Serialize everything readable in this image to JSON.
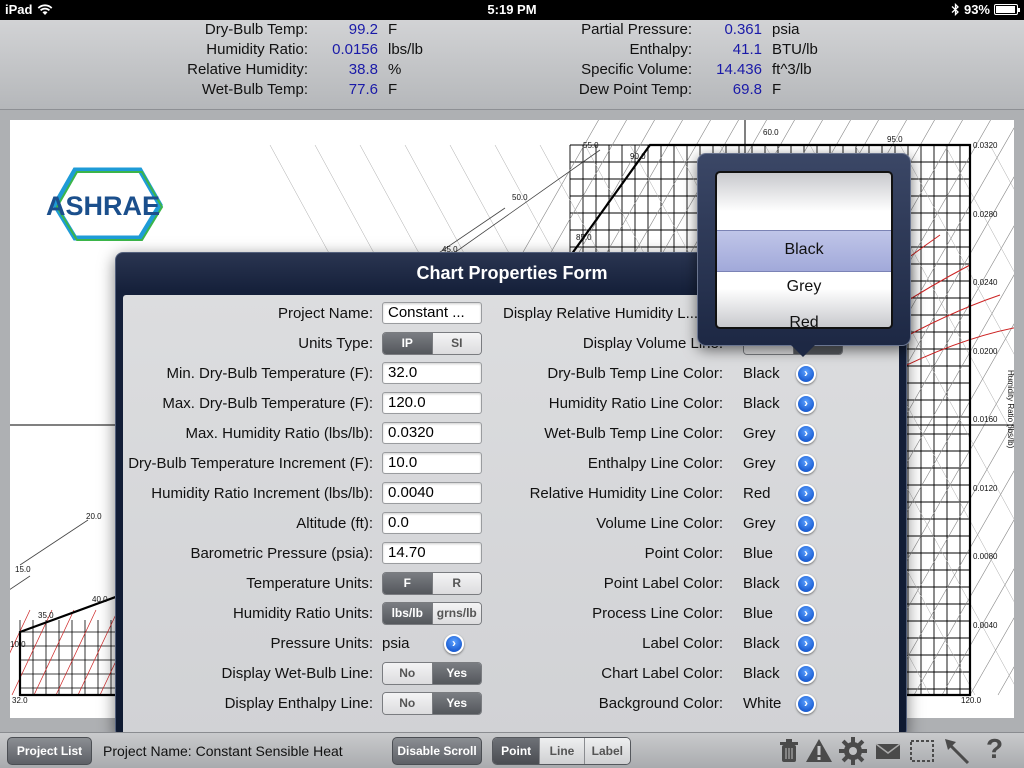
{
  "status_bar": {
    "device": "iPad",
    "time": "5:19 PM",
    "battery_pct": "93%",
    "battery_level": 0.93
  },
  "readouts": {
    "left": [
      {
        "label": "Dry-Bulb Temp:",
        "value": "99.2",
        "unit": "F"
      },
      {
        "label": "Humidity Ratio:",
        "value": "0.0156",
        "unit": "lbs/lb"
      },
      {
        "label": "Relative Humidity:",
        "value": "38.8",
        "unit": "%"
      },
      {
        "label": "Wet-Bulb Temp:",
        "value": "77.6",
        "unit": "F"
      }
    ],
    "right": [
      {
        "label": "Partial Pressure:",
        "value": "0.361",
        "unit": "psia"
      },
      {
        "label": "Enthalpy:",
        "value": "41.1",
        "unit": "BTU/lb"
      },
      {
        "label": "Specific Volume:",
        "value": "14.436",
        "unit": "ft^3/lb"
      },
      {
        "label": "Dew Point Temp:",
        "value": "69.8",
        "unit": "F"
      }
    ]
  },
  "chart": {
    "logo_text": "ASHRAE",
    "top_labels": [
      "55.0",
      "60.0",
      "95.0",
      "90.0",
      "50.0",
      "85.0",
      "45.0"
    ],
    "left_labels": [
      "20.0",
      "15.0",
      "10.0",
      "35.0",
      "40.0"
    ],
    "bottom_labels": [
      "32.0",
      "120.0"
    ],
    "right_axis_ticks": [
      "0.0320",
      "0.0280",
      "0.0240",
      "0.0200",
      "0.0160",
      "0.0120",
      "0.0080",
      "0.0040"
    ],
    "right_axis_title": "Humidity Ratio (lbs/lb)"
  },
  "form": {
    "title": "Chart Properties Form",
    "left_fields": [
      {
        "label": "Project Name:",
        "type": "text",
        "value": "Constant ..."
      },
      {
        "label": "Units Type:",
        "type": "segment",
        "options": [
          "IP",
          "SI"
        ],
        "selected": 0
      },
      {
        "label": "Min. Dry-Bulb Temperature (F):",
        "type": "text",
        "value": "32.0"
      },
      {
        "label": "Max. Dry-Bulb Temperature (F):",
        "type": "text",
        "value": "120.0"
      },
      {
        "label": "Max. Humidity Ratio (lbs/lb):",
        "type": "text",
        "value": "0.0320"
      },
      {
        "label": "Dry-Bulb Temperature Increment (F):",
        "type": "text",
        "value": "10.0"
      },
      {
        "label": "Humidity Ratio Increment (lbs/lb):",
        "type": "text",
        "value": "0.0040"
      },
      {
        "label": "Altitude (ft):",
        "type": "text",
        "value": "0.0"
      },
      {
        "label": "Barometric Pressure (psia):",
        "type": "text",
        "value": "14.70"
      },
      {
        "label": "Temperature Units:",
        "type": "segment",
        "options": [
          "F",
          "R"
        ],
        "selected": 0
      },
      {
        "label": "Humidity Ratio Units:",
        "type": "segment",
        "options": [
          "lbs/lb",
          "grns/lb"
        ],
        "selected": 0
      },
      {
        "label": "Pressure Units:",
        "type": "disclosure",
        "value": "psia"
      },
      {
        "label": "Display Wet-Bulb Line:",
        "type": "segment",
        "options": [
          "No",
          "Yes"
        ],
        "selected": 1
      },
      {
        "label": "Display Enthalpy Line:",
        "type": "segment",
        "options": [
          "No",
          "Yes"
        ],
        "selected": 1
      }
    ],
    "right_fields": [
      {
        "label": "Display Relative Humidity L...",
        "type": "hidden"
      },
      {
        "label": "Display Volume Line:",
        "type": "hidden"
      },
      {
        "label": "Dry-Bulb Temp Line Color:",
        "value": "Black"
      },
      {
        "label": "Humidity Ratio Line Color:",
        "value": "Black"
      },
      {
        "label": "Wet-Bulb Temp Line Color:",
        "value": "Grey"
      },
      {
        "label": "Enthalpy Line Color:",
        "value": "Grey"
      },
      {
        "label": "Relative Humidity Line Color:",
        "value": "Red"
      },
      {
        "label": "Volume Line Color:",
        "value": "Grey"
      },
      {
        "label": "Point Color:",
        "value": "Blue"
      },
      {
        "label": "Point Label Color:",
        "value": "Black"
      },
      {
        "label": "Process Line Color:",
        "value": "Blue"
      },
      {
        "label": "Label Color:",
        "value": "Black"
      },
      {
        "label": "Chart Label Color:",
        "value": "Black"
      },
      {
        "label": "Background Color:",
        "value": "White"
      }
    ]
  },
  "picker": {
    "options": [
      "Black",
      "Grey",
      "Red"
    ],
    "selected": "Black"
  },
  "toolbar": {
    "project_list_label": "Project List",
    "project_name": "Project Name: Constant Sensible Heat",
    "disable_scroll_label": "Disable Scroll",
    "modes": [
      "Point",
      "Line",
      "Label"
    ],
    "selected_mode": "Point"
  },
  "colors": {
    "value_blue": "#1a1aa8",
    "rh_red": "#cc2222",
    "disclosure_blue": "#1d5fd3",
    "popover_navy": "#15203a"
  }
}
